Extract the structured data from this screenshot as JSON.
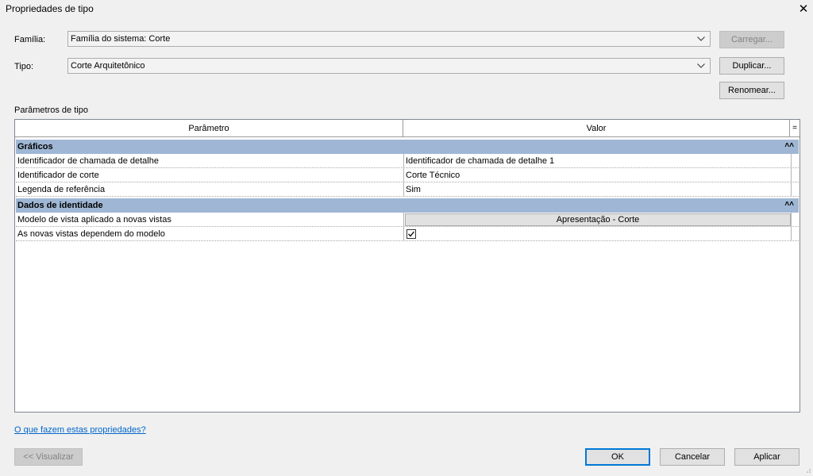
{
  "window": {
    "title": "Propriedades de tipo"
  },
  "family": {
    "label": "Família:",
    "value": "Família do sistema: Corte"
  },
  "type": {
    "label": "Tipo:",
    "value": "Corte Arquitetônico"
  },
  "buttons": {
    "load": "Carregar...",
    "duplicate": "Duplicar...",
    "rename": "Renomear..."
  },
  "section_label": "Parâmetros de tipo",
  "table": {
    "col_param": "Parâmetro",
    "col_value": "Valor",
    "col_menu": "=",
    "groups": [
      {
        "name": "Gráficos",
        "rows": [
          {
            "param": "Identificador de chamada de detalhe",
            "value": "Identificador de chamada de detalhe 1"
          },
          {
            "param": "Identificador de corte",
            "value": "Corte Técnico"
          },
          {
            "param": "Legenda de referência",
            "value": "Sim"
          }
        ]
      },
      {
        "name": "Dados de identidade",
        "rows": [
          {
            "param": "Modelo de vista aplicado a novas vistas",
            "value": "Apresentação - Corte"
          },
          {
            "param": "As novas vistas dependem do modelo",
            "value": "",
            "checked": true
          }
        ]
      }
    ]
  },
  "help_link": "O que fazem estas propriedades?",
  "footer": {
    "preview": "<< Visualizar",
    "ok": "OK",
    "cancel": "Cancelar",
    "apply": "Aplicar"
  }
}
